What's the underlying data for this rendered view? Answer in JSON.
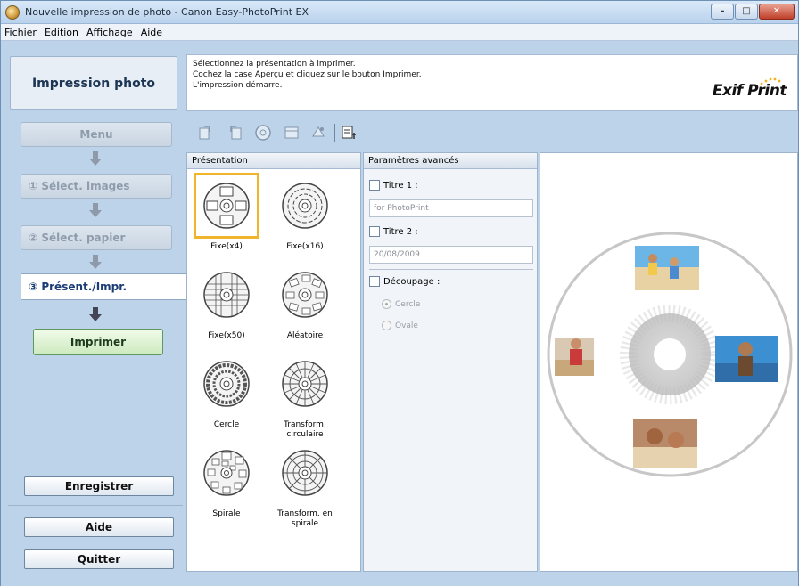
{
  "window": {
    "title": "Nouvelle impression de photo - Canon Easy-PhotoPrint EX",
    "minimize_glyph": "–",
    "maximize_glyph": "□",
    "close_glyph": "✕"
  },
  "menubar": [
    "Fichier",
    "Edition",
    "Affichage",
    "Aide"
  ],
  "sidebar": {
    "header": "Impression photo",
    "menu_button": "Menu",
    "steps": [
      {
        "label": "① Sélect. images",
        "state": "done"
      },
      {
        "label": "② Sélect. papier",
        "state": "done"
      },
      {
        "label": "③ Présent./Impr.",
        "state": "active"
      }
    ],
    "print_button": "Imprimer",
    "save_button": "Enregistrer",
    "help_button": "Aide",
    "quit_button": "Quitter"
  },
  "instructions": {
    "lines": [
      "Sélectionnez la présentation à imprimer.",
      "Cochez la case Aperçu et cliquez sur le bouton Imprimer.",
      "L'impression démarre."
    ],
    "logo": "Exif Print"
  },
  "toolbar": {
    "icons": [
      "rotate-left-icon",
      "rotate-right-icon",
      "disc-icon",
      "grid-icon",
      "star-effect-icon",
      "print-settings-icon"
    ]
  },
  "presentation": {
    "header": "Présentation",
    "items": [
      {
        "label": "Fixe(x4)",
        "selected": true
      },
      {
        "label": "Fixe(x16)",
        "selected": false
      },
      {
        "label": "Fixe(x50)",
        "selected": false
      },
      {
        "label": "Aléatoire",
        "selected": false
      },
      {
        "label": "Cercle",
        "selected": false
      },
      {
        "label": "Transform. circulaire",
        "selected": false
      },
      {
        "label": "Spirale",
        "selected": false
      },
      {
        "label": "Transform. en spirale",
        "selected": false
      }
    ]
  },
  "advanced": {
    "header": "Paramètres avancés",
    "title1_label": "Titre 1 :",
    "title1_value": "for PhotoPrint",
    "title2_label": "Titre 2 :",
    "title2_value": "20/08/2009",
    "crop_label": "Découpage :",
    "crop_options": [
      "Cercle",
      "Ovale"
    ],
    "crop_selected": "Cercle"
  },
  "colors": {
    "window_bg": "#bcd3ea",
    "selected_border": "#f1b52b",
    "print_button_green": "#cdeabf",
    "active_step_text": "#1b3c76"
  }
}
